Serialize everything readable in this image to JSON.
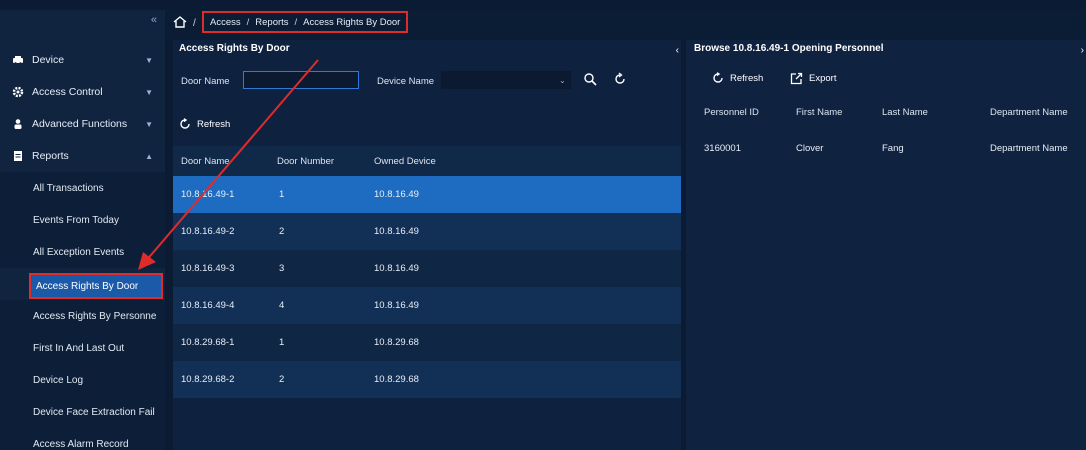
{
  "sidebar": {
    "collapse_glyph": "«",
    "menu": [
      {
        "label": "Device",
        "icon": "car-icon"
      },
      {
        "label": "Access Control",
        "icon": "gear-icon"
      },
      {
        "label": "Advanced Functions",
        "icon": "person-icon"
      },
      {
        "label": "Reports",
        "icon": "document-icon"
      }
    ],
    "reports_items": [
      "All Transactions",
      "Events From Today",
      "All Exception Events",
      "Access Rights By Door",
      "Access Rights By Personne",
      "First In And Last Out",
      "Device Log",
      "Device Face Extraction Fail",
      "Access Alarm Record"
    ],
    "active_item": "Access Rights By Door"
  },
  "breadcrumb": {
    "items": [
      "Access",
      "Reports",
      "Access Rights By Door"
    ],
    "separator": "/"
  },
  "left_panel": {
    "title": "Access Rights By Door",
    "door_name_label": "Door Name",
    "door_name_value": "",
    "device_name_label": "Device Name",
    "device_name_value": "",
    "refresh_label": "Refresh",
    "columns": [
      "Door Name",
      "Door Number",
      "Owned Device"
    ],
    "rows": [
      [
        "10.8.16.49-1",
        "1",
        "10.8.16.49"
      ],
      [
        "10.8.16.49-2",
        "2",
        "10.8.16.49"
      ],
      [
        "10.8.16.49-3",
        "3",
        "10.8.16.49"
      ],
      [
        "10.8.16.49-4",
        "4",
        "10.8.16.49"
      ],
      [
        "10.8.29.68-1",
        "1",
        "10.8.29.68"
      ],
      [
        "10.8.29.68-2",
        "2",
        "10.8.29.68"
      ]
    ],
    "selected_row": 0
  },
  "right_panel": {
    "title": "Browse 10.8.16.49-1 Opening Personnel",
    "refresh_label": "Refresh",
    "export_label": "Export",
    "columns": [
      "Personnel ID",
      "First Name",
      "Last Name",
      "Department Name"
    ],
    "rows": [
      [
        "3160001",
        "Clover",
        "Fang",
        "Department Name"
      ]
    ]
  },
  "colors": {
    "background": "#0a1b33",
    "sidebar": "#102440",
    "selected_row": "#1e6cc1",
    "highlight": "#e02b2b"
  }
}
